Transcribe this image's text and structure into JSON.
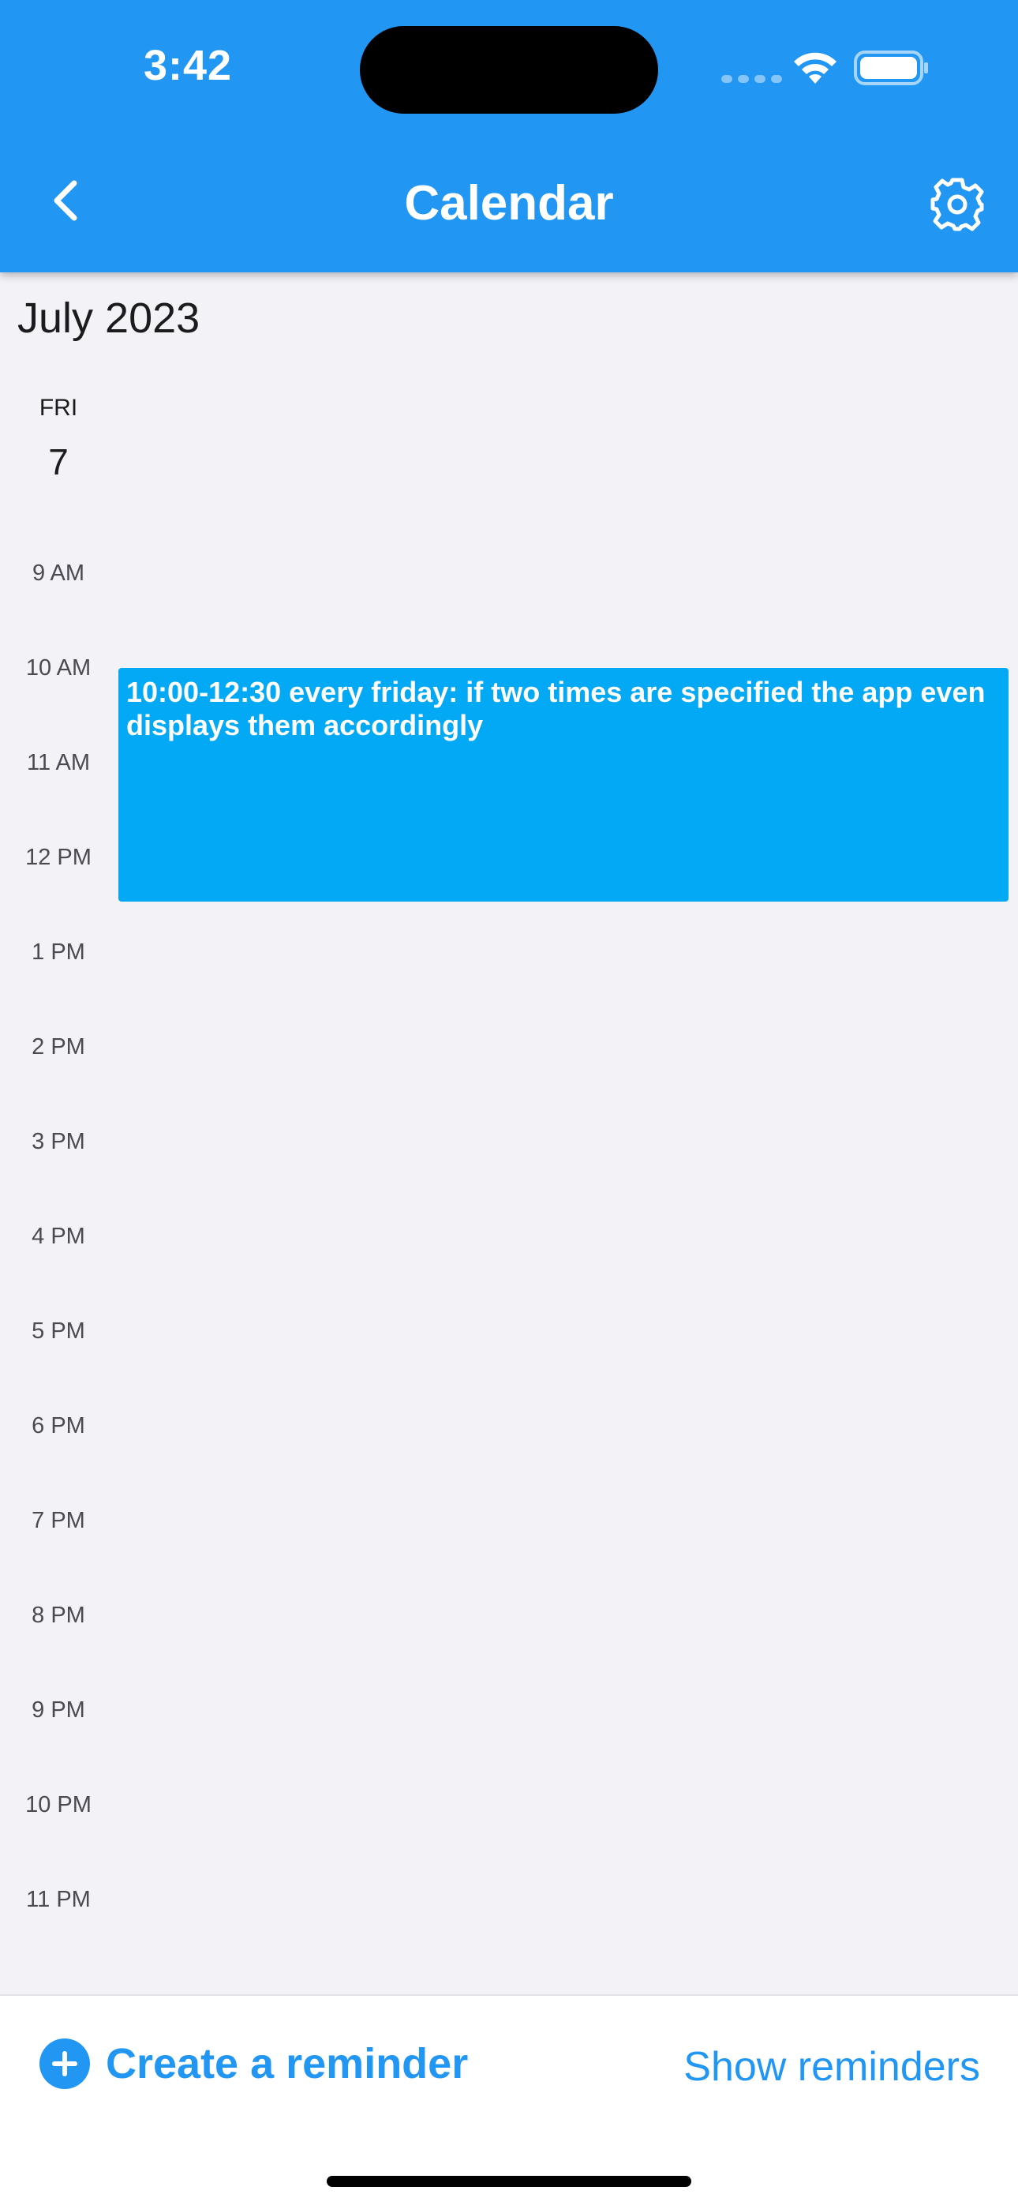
{
  "status_bar": {
    "time": "3:42"
  },
  "header": {
    "title": "Calendar",
    "back_icon": "chevron-left-icon",
    "settings_icon": "gear-icon",
    "background_color": "#2196F3"
  },
  "calendar": {
    "month_title": "July 2023",
    "day": {
      "weekday": "FRI",
      "date": "7"
    },
    "hours": [
      "9 AM",
      "10 AM",
      "11 AM",
      "12 PM",
      "1 PM",
      "2 PM",
      "3 PM",
      "4 PM",
      "5 PM",
      "6 PM",
      "7 PM",
      "8 PM",
      "9 PM",
      "10 PM",
      "11 PM"
    ],
    "events": [
      {
        "title": " 10:00-12:30 every friday: if two times are specified the app even displays them accordingly",
        "start": "10:00",
        "end": "12:30",
        "color": "#03A9F4"
      }
    ]
  },
  "bottom_bar": {
    "create_label": "Create a reminder",
    "show_label": "Show reminders",
    "accent_color": "#2196F3"
  }
}
